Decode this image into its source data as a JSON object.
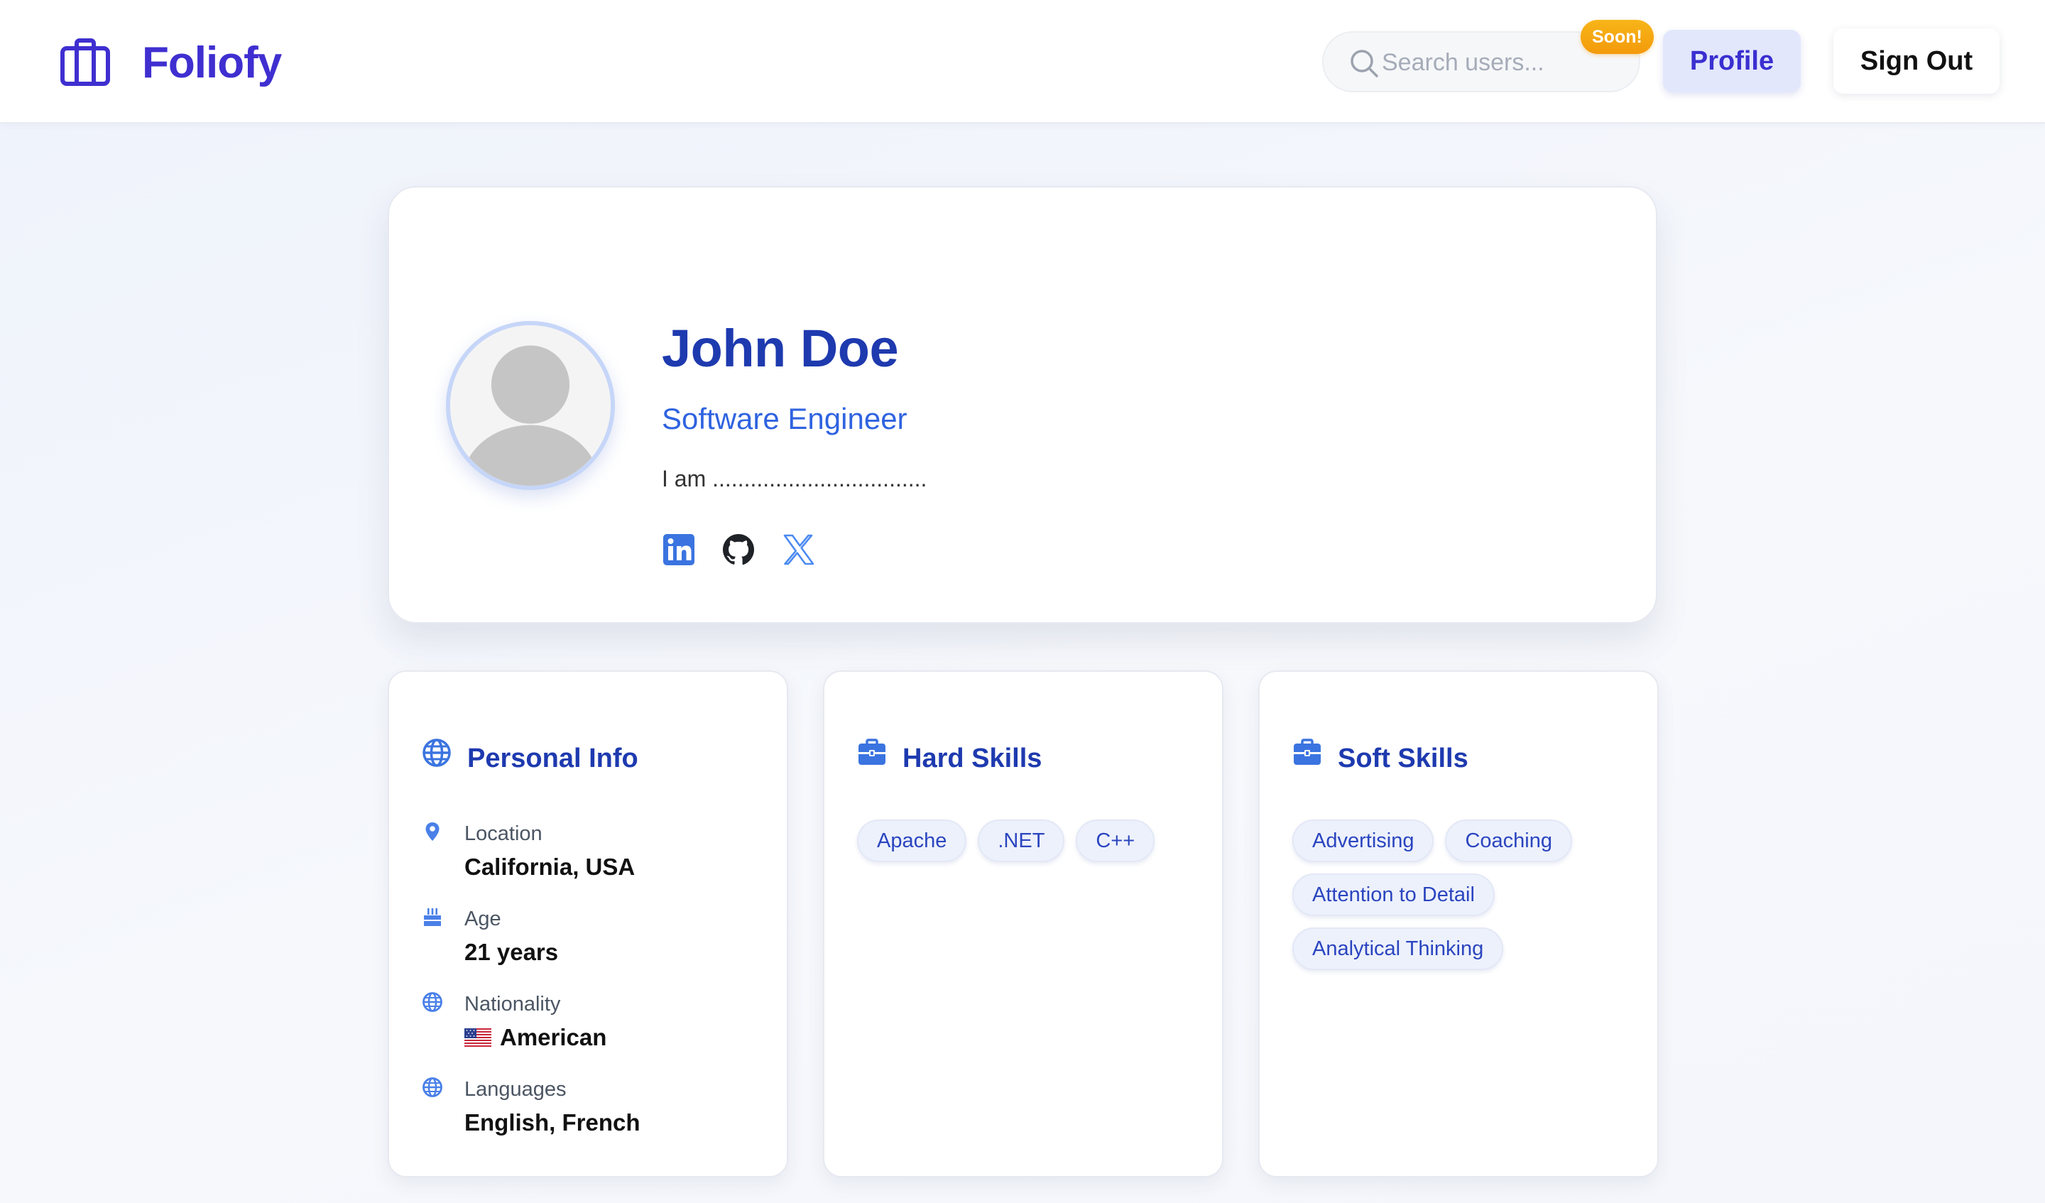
{
  "header": {
    "brand_name": "Foliofy",
    "search_placeholder": "Search users...",
    "soon_badge": "Soon!",
    "profile_label": "Profile",
    "signout_label": "Sign Out"
  },
  "profile": {
    "name": "John Doe",
    "title": "Software Engineer",
    "bio": "I am ..................................",
    "socials": [
      "linkedin-icon",
      "github-icon",
      "x-icon"
    ]
  },
  "personal_info": {
    "title": "Personal Info",
    "rows": [
      {
        "label": "Location",
        "value": "California, USA",
        "icon": "map-pin-icon"
      },
      {
        "label": "Age",
        "value": "21 years",
        "icon": "cake-icon"
      },
      {
        "label": "Nationality",
        "value": "American",
        "icon": "globe-icon",
        "flag": "us-flag"
      },
      {
        "label": "Languages",
        "value": "English, French",
        "icon": "globe-icon"
      }
    ]
  },
  "hard_skills": {
    "title": "Hard Skills",
    "tags": [
      "Apache",
      ".NET",
      "C++"
    ]
  },
  "soft_skills": {
    "title": "Soft Skills",
    "tags": [
      "Advertising",
      "Coaching",
      "Attention to Detail",
      "Analytical Thinking"
    ]
  },
  "colors": {
    "brand": "#3f2fd0",
    "heading": "#1e3aaf",
    "accent": "#2f63e0",
    "badge": "#f5a90f",
    "tag_bg": "#edf1fc"
  }
}
